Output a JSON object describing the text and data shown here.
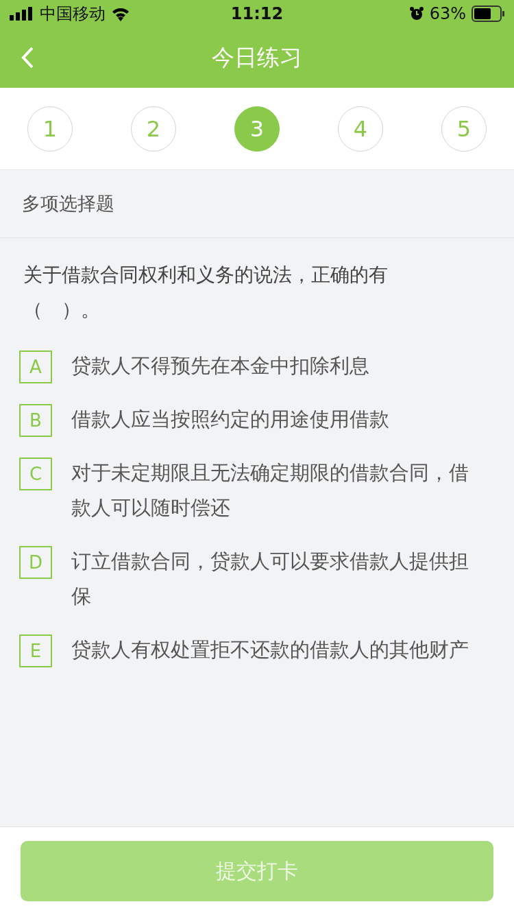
{
  "status_bar": {
    "carrier": "中国移动",
    "time": "11:12",
    "battery": "63%"
  },
  "nav": {
    "title": "今日练习"
  },
  "question_tabs": [
    {
      "label": "1",
      "selected": false
    },
    {
      "label": "2",
      "selected": false
    },
    {
      "label": "3",
      "selected": true
    },
    {
      "label": "4",
      "selected": false
    },
    {
      "label": "5",
      "selected": false
    }
  ],
  "question_type": "多项选择题",
  "question": "关于借款合同权利和义务的说法，正确的有（　）。",
  "options": [
    {
      "letter": "A",
      "text": "贷款人不得预先在本金中扣除利息",
      "selected": false
    },
    {
      "letter": "B",
      "text": "借款人应当按照约定的用途使用借款",
      "selected": false
    },
    {
      "letter": "C",
      "text": "对于未定期限且无法确定期限的借款合同，借款人可以随时偿还",
      "selected": false
    },
    {
      "letter": "D",
      "text": "订立借款合同，贷款人可以要求借款人提供担保",
      "selected": false
    },
    {
      "letter": "E",
      "text": "贷款人有权处置拒不还款的借款人的其他财产",
      "selected": false
    }
  ],
  "submit": {
    "label": "提交打卡",
    "disabled": true
  }
}
